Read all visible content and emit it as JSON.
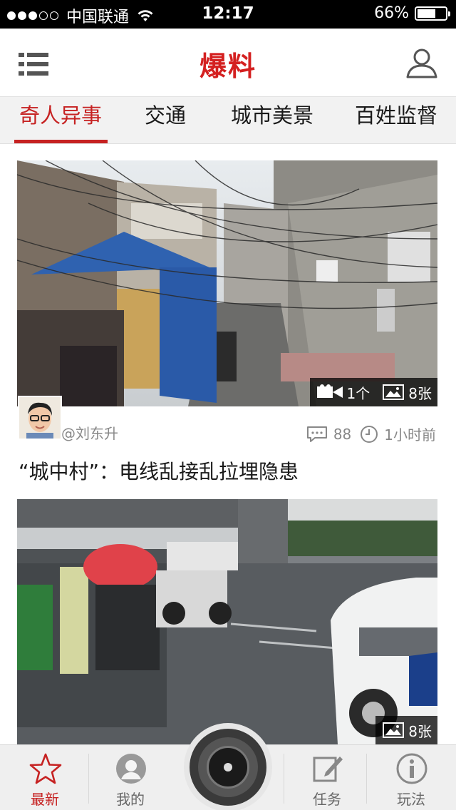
{
  "status_bar": {
    "signal_filled": 3,
    "signal_total": 5,
    "carrier": "中国联通",
    "time": "12:17",
    "battery": "66%",
    "battery_level": 0.66
  },
  "header": {
    "title": "爆料",
    "menu_icon": "menu-icon",
    "user_icon": "user-icon",
    "title_color": "#d42020"
  },
  "tabs": [
    {
      "label": "奇人异事",
      "active": true
    },
    {
      "label": "交通",
      "active": false
    },
    {
      "label": "城市美景",
      "active": false
    },
    {
      "label": "百姓监督",
      "active": false
    }
  ],
  "feed": [
    {
      "video_count": "1个",
      "photo_count": "8张",
      "author": "@刘东升",
      "comments": "88",
      "time": "1小时前",
      "headline": "“城中村”：电线乱接乱拉埋隐患"
    },
    {
      "photo_count": "8张"
    }
  ],
  "tabbar": {
    "items": [
      {
        "label": "最新",
        "icon": "star-icon",
        "active": true
      },
      {
        "label": "我的",
        "icon": "person-icon",
        "active": false
      },
      {
        "label": "任务",
        "icon": "edit-icon",
        "active": false
      },
      {
        "label": "玩法",
        "icon": "info-icon",
        "active": false
      }
    ],
    "camera_icon": "camera-icon"
  },
  "colors": {
    "accent": "#c62222",
    "tab_bg": "#f2f2f2",
    "tabbar_bg": "#efefef"
  }
}
